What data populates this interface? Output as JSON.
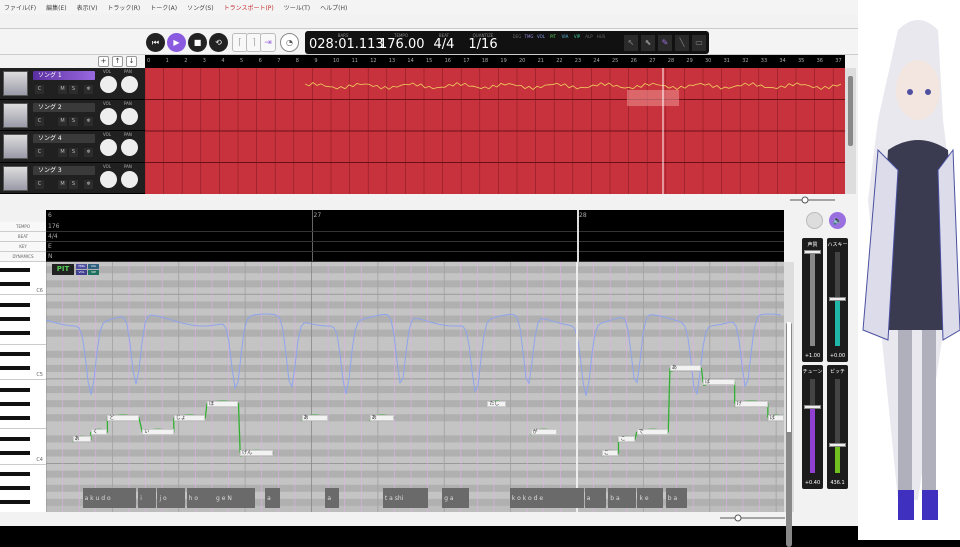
{
  "menu": [
    "ファイル(F)",
    "編集(E)",
    "表示(V)",
    "トラック(R)",
    "トーク(A)",
    "ソング(S)",
    "トランスポート(P)",
    "ツール(T)",
    "ヘルプ(H)"
  ],
  "transport": {
    "bars_label": "BARS",
    "bars": "028:01.113",
    "tempo_label": "TEMPO",
    "tempo": "176.00",
    "beat_label": "BEAT",
    "beat": "4/4",
    "quantize_label": "QUANTIZE",
    "quantize": "1/16"
  },
  "switches": [
    "DEG",
    "TMG",
    "VOL",
    "PIT",
    "VIA",
    "VIP",
    "ALP",
    "HUS"
  ],
  "active_switch": "PIT",
  "tracks": [
    {
      "name": "ソング 1",
      "selected": true
    },
    {
      "name": "ソング 2"
    },
    {
      "name": "ソング 4"
    },
    {
      "name": "ソング 3"
    }
  ],
  "track_buttons": {
    "c": "C",
    "m": "M",
    "s": "S",
    "fx": "❄",
    "vol": "VOL",
    "pan": "PAN"
  },
  "header_buttons": [
    "+",
    "↑",
    "↓"
  ],
  "bar_numbers": [
    0,
    1,
    2,
    3,
    4,
    5,
    6,
    7,
    8,
    9,
    10,
    11,
    12,
    13,
    14,
    15,
    16,
    17,
    18,
    19,
    20,
    21,
    22,
    23,
    24,
    25,
    26,
    27,
    28,
    29,
    30,
    31,
    32,
    33,
    34,
    35,
    36,
    37
  ],
  "ctrl_labels": [
    "TEMPO",
    "BEAT",
    "KEY",
    "DYNAMICS"
  ],
  "ruler": {
    "bars": [
      "6",
      "27",
      "28"
    ],
    "tempo": "176",
    "beat": "4/4",
    "key": "E",
    "dynamics": "N"
  },
  "key_labels": [
    "C6",
    "C5",
    "C4"
  ],
  "pit_badge": "PIT",
  "mini_badges": [
    "TMG",
    "VIA",
    "VOL",
    "VIP"
  ],
  "notes": [
    {
      "lyric": "あ",
      "start": 1.6,
      "len": 1.1,
      "key": 3
    },
    {
      "lyric": "く",
      "start": 2.7,
      "len": 1.0,
      "key": 4
    },
    {
      "lyric": "ど",
      "start": 3.7,
      "len": 1.9,
      "key": 6
    },
    {
      "lyric": "い",
      "start": 5.8,
      "len": 1.9,
      "key": 4
    },
    {
      "lyric": "じょ",
      "start": 7.7,
      "len": 1.9,
      "key": 6
    },
    {
      "lyric": "ほ",
      "start": 9.7,
      "len": 1.9,
      "key": 8
    },
    {
      "lyric": "げん",
      "start": 11.7,
      "len": 2.0,
      "key": 1
    },
    {
      "lyric": "あ",
      "start": 15.4,
      "len": 1.6,
      "key": 6
    },
    {
      "lyric": "あ",
      "start": 19.5,
      "len": 1.5,
      "key": 6
    },
    {
      "lyric": "たし",
      "start": 26.6,
      "len": 1.1,
      "key": 8
    },
    {
      "lyric": "が",
      "start": 29.2,
      "len": 1.6,
      "key": 4
    },
    {
      "lyric": "こ",
      "start": 33.5,
      "len": 1.0,
      "key": 1
    },
    {
      "lyric": "こ",
      "start": 34.5,
      "len": 1.0,
      "key": 3
    },
    {
      "lyric": "で",
      "start": 35.6,
      "len": 1.9,
      "key": 4
    },
    {
      "lyric": "あ",
      "start": 37.6,
      "len": 1.9,
      "key": 13
    },
    {
      "lyric": "ば",
      "start": 39.6,
      "len": 1.9,
      "key": 11
    },
    {
      "lyric": "け",
      "start": 41.5,
      "len": 2.0,
      "key": 8
    },
    {
      "lyric": "ば",
      "start": 43.5,
      "len": 1.0,
      "key": 6
    }
  ],
  "phonemes": [
    {
      "t": 1.6,
      "len": 5.9,
      "text": "a  k  u d o"
    },
    {
      "t": 7.7,
      "len": 1.9,
      "text": "i"
    },
    {
      "t": 9.8,
      "len": 3.0,
      "text": "j    o"
    },
    {
      "t": 13.0,
      "len": 3.0,
      "text": "h    o"
    },
    {
      "t": 16.0,
      "len": 4.5,
      "text": "g    e       N"
    },
    {
      "t": 21.6,
      "len": 1.6,
      "text": "a"
    },
    {
      "t": 28.2,
      "len": 1.5,
      "text": "a"
    },
    {
      "t": 34.5,
      "len": 4.9,
      "text": "t     a  shi"
    },
    {
      "t": 41.0,
      "len": 2.9,
      "text": "g  a"
    },
    {
      "t": 48.4,
      "len": 8.1,
      "text": "k       o  k  o  d  e"
    },
    {
      "t": 56.6,
      "len": 2.3,
      "text": "a"
    },
    {
      "t": 59.2,
      "len": 3.0,
      "text": "b    a"
    },
    {
      "t": 62.4,
      "len": 2.8,
      "text": "k    e"
    },
    {
      "t": 65.5,
      "len": 2.3,
      "text": "b    a"
    }
  ],
  "sliders": [
    {
      "label": "声質",
      "value": "+1.00",
      "level": 1.0,
      "color": "#888888"
    },
    {
      "label": "ハスキー",
      "value": "+0.00",
      "level": 0.5,
      "color": "#1fb8a8"
    },
    {
      "label": "チューン",
      "value": "+0.40",
      "level": 0.7,
      "color": "#9040d0"
    },
    {
      "label": "ピッチ",
      "value": "436.1",
      "level": 0.3,
      "color": "#70c020"
    }
  ],
  "colors": {
    "accent": "#8a5ae0",
    "lane": "#c8323c",
    "pitch": "#33b033",
    "dynamics": "#8fa4ee"
  }
}
